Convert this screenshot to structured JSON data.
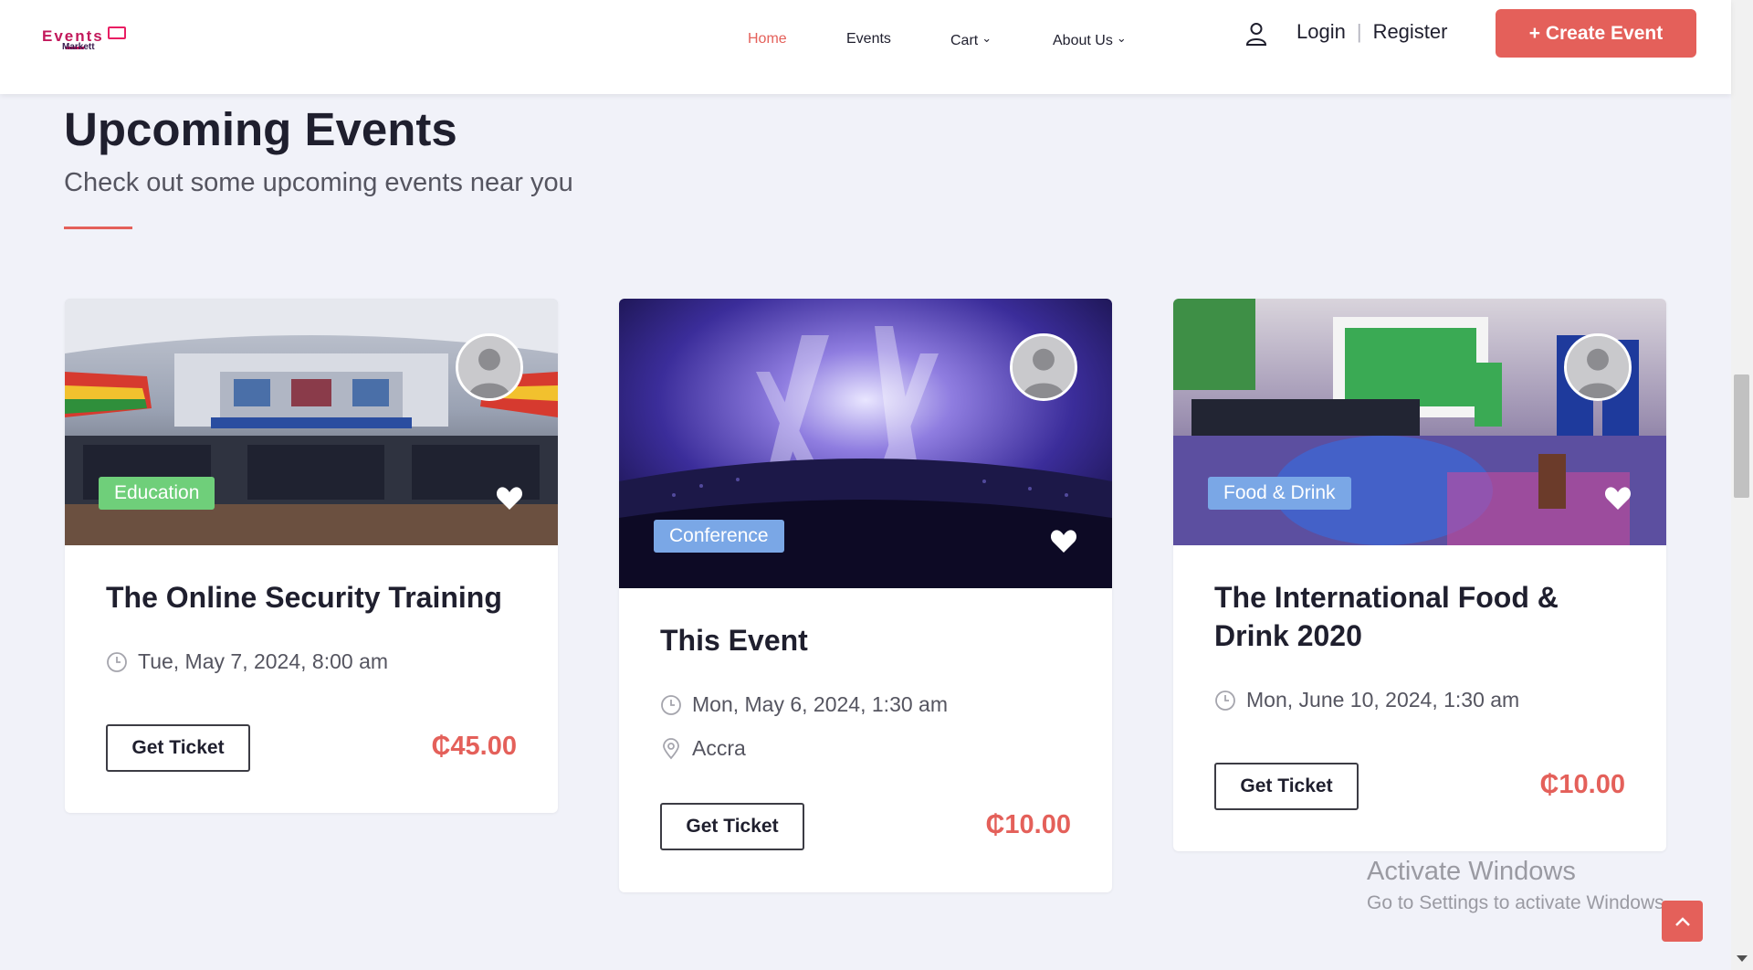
{
  "header": {
    "logo_text_1": "Events",
    "logo_text_2": "Markett",
    "nav": [
      {
        "label": "Home",
        "active": true
      },
      {
        "label": "Events",
        "active": false
      },
      {
        "label": "Cart",
        "has_dropdown": true
      },
      {
        "label": "About Us",
        "has_dropdown": true
      }
    ],
    "login": "Login",
    "separator": "|",
    "register": "Register",
    "create_event": "+ Create Event"
  },
  "section": {
    "title": "Upcoming Events",
    "subtitle": "Check out some upcoming events near you"
  },
  "cards": [
    {
      "category": "Education",
      "category_color": "#6fcf7a",
      "title": "The Online Security Training",
      "date": "Tue, May 7, 2024, 8:00 am",
      "button": "Get Ticket",
      "price": "₵45.00"
    },
    {
      "category": "Conference",
      "category_color": "#7aa7e6",
      "title": "This Event",
      "date": "Mon, May 6, 2024, 1:30 am",
      "location": "Accra",
      "button": "Get Ticket",
      "price": "₵10.00"
    },
    {
      "category": "Food & Drink",
      "category_color": "#7aa7e6",
      "title": "The International Food & Drink 2020",
      "date": "Mon, June 10, 2024, 1:30 am",
      "button": "Get Ticket",
      "price": "₵10.00"
    }
  ],
  "watermark": {
    "line1": "Activate Windows",
    "line2": "Go to Settings to activate Windows."
  },
  "colors": {
    "accent": "#e4605a",
    "background": "#f1f2f9"
  }
}
